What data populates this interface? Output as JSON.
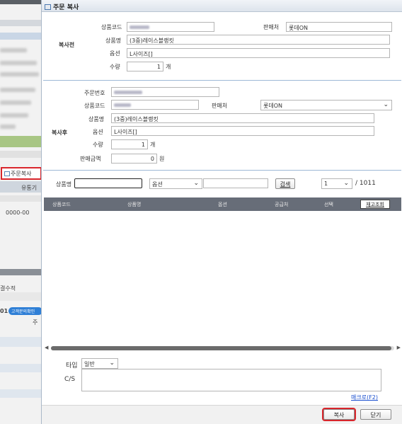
{
  "background": {
    "copy_button_label": "주문복사",
    "column_label": "유통기",
    "date_value": "0000-00",
    "filter_label": "결수적",
    "row_number": "01",
    "pill_label": "고객문의확인",
    "cell_text": "주"
  },
  "dialog": {
    "title": "주문 복사",
    "before": {
      "section_label": "복사전",
      "product_code_label": "상품코드",
      "seller_label": "판매처",
      "seller_value": "롯데ON",
      "product_name_label": "상품명",
      "product_name_value": "(3중)레이스블랭킷",
      "option_label": "옵션",
      "option_value": "L사이즈[]",
      "qty_label": "수량",
      "qty_value": "1",
      "qty_unit": "개"
    },
    "after": {
      "section_label": "복사후",
      "order_no_label": "주문번호",
      "product_code_label": "상품코드",
      "seller_label": "판매처",
      "seller_value": "롯데ON",
      "product_name_label": "상품명",
      "product_name_value": "(3중)레이스블랭킷",
      "option_label": "옵션",
      "option_value": "L사이즈[]",
      "qty_label": "수량",
      "qty_value": "1",
      "qty_unit": "개",
      "sale_amount_label": "판매금액",
      "sale_amount_value": "0",
      "sale_amount_unit": "원"
    },
    "search": {
      "product_name_label": "상품명",
      "product_name_value": "",
      "option_select": "옵션",
      "option_text_value": "",
      "search_button": "검색",
      "page_select": "1",
      "page_total": "/ 1011"
    },
    "grid": {
      "columns": [
        "상품코드",
        "상품명",
        "옵션",
        "공급처",
        "선택"
      ],
      "stock_button": "재고조회"
    },
    "type_label": "타입",
    "type_value": "일반",
    "cs_label": "C/S",
    "cs_value": "",
    "macro_link": "매크로(F2)",
    "copy_button": "복사",
    "close_button": "닫기"
  }
}
